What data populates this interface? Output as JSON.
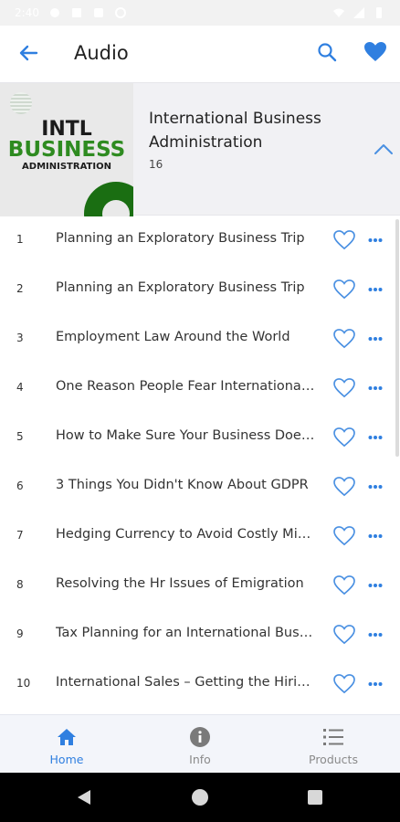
{
  "statusbar": {
    "time": "2:40",
    "icons": [
      "settings-icon",
      "sim-icon",
      "card-icon",
      "hotspot-icon",
      "wifi-icon",
      "signal-icon",
      "battery-icon"
    ]
  },
  "appbar": {
    "title": "Audio",
    "icons": [
      "back-arrow-icon",
      "search-icon",
      "heart-filled-icon"
    ]
  },
  "album": {
    "cover": {
      "line1": "INTL",
      "line2": "BUSINESS",
      "line3": "ADMINISTRATION"
    },
    "title": "International Business Administration",
    "count": "16",
    "collapse_icon": "chevron-up-icon"
  },
  "tracks": [
    {
      "num": "1",
      "title": "Planning an Exploratory Business Trip"
    },
    {
      "num": "2",
      "title": "Planning an Exploratory Business Trip"
    },
    {
      "num": "3",
      "title": "Employment Law Around the World"
    },
    {
      "num": "4",
      "title": "One Reason People Fear International Business"
    },
    {
      "num": "5",
      "title": "How to Make Sure Your Business Doesn't Fail"
    },
    {
      "num": "6",
      "title": "3 Things You Didn't Know About GDPR"
    },
    {
      "num": "7",
      "title": "Hedging Currency to Avoid Costly Mistakes"
    },
    {
      "num": "8",
      "title": "Resolving the Hr Issues of Emigration"
    },
    {
      "num": "9",
      "title": "Tax Planning for an International Business"
    },
    {
      "num": "10",
      "title": "International Sales – Getting the Hiring Right"
    }
  ],
  "bottomnav": {
    "items": [
      {
        "label": "Home",
        "icon": "home-icon",
        "active": true
      },
      {
        "label": "Info",
        "icon": "info-icon",
        "active": false
      },
      {
        "label": "Products",
        "icon": "list-icon",
        "active": false
      }
    ]
  },
  "colors": {
    "accent": "#2f7fe0",
    "heart_outline": "#4a90e2",
    "cover_green": "#2e8b20"
  }
}
